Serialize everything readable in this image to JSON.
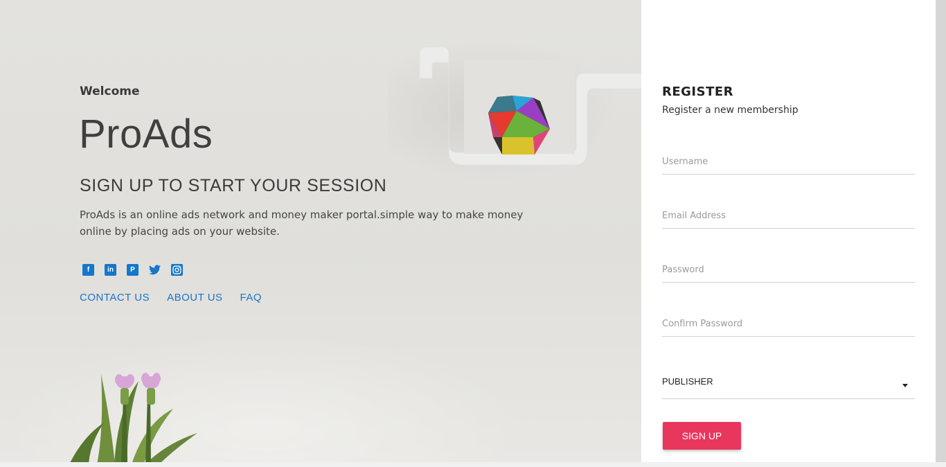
{
  "hero": {
    "welcome": "Welcome",
    "brand": "ProAds",
    "headline": "SIGN UP TO START YOUR SESSION",
    "description": "ProAds is an online ads network and money maker portal.simple way to make money online by placing ads on your website."
  },
  "socials": [
    {
      "name": "facebook-icon",
      "glyph": "f"
    },
    {
      "name": "linkedin-icon",
      "glyph": "in"
    },
    {
      "name": "pinterest-icon",
      "glyph": "P"
    },
    {
      "name": "twitter-icon",
      "glyph": "🐦"
    },
    {
      "name": "instagram-icon",
      "glyph": "◎"
    }
  ],
  "links": {
    "contact": "CONTACT US",
    "about": "ABOUT US",
    "faq": "FAQ"
  },
  "register": {
    "title": "REGISTER",
    "subtitle": "Register a new membership",
    "username_placeholder": "Username",
    "email_placeholder": "Email Address",
    "password_placeholder": "Password",
    "confirm_placeholder": "Confirm Password",
    "account_type": "PUBLISHER",
    "submit_label": "SIGN UP"
  },
  "colors": {
    "accent": "#e8365d",
    "link": "#1a73c9",
    "social": "#1577c9"
  }
}
